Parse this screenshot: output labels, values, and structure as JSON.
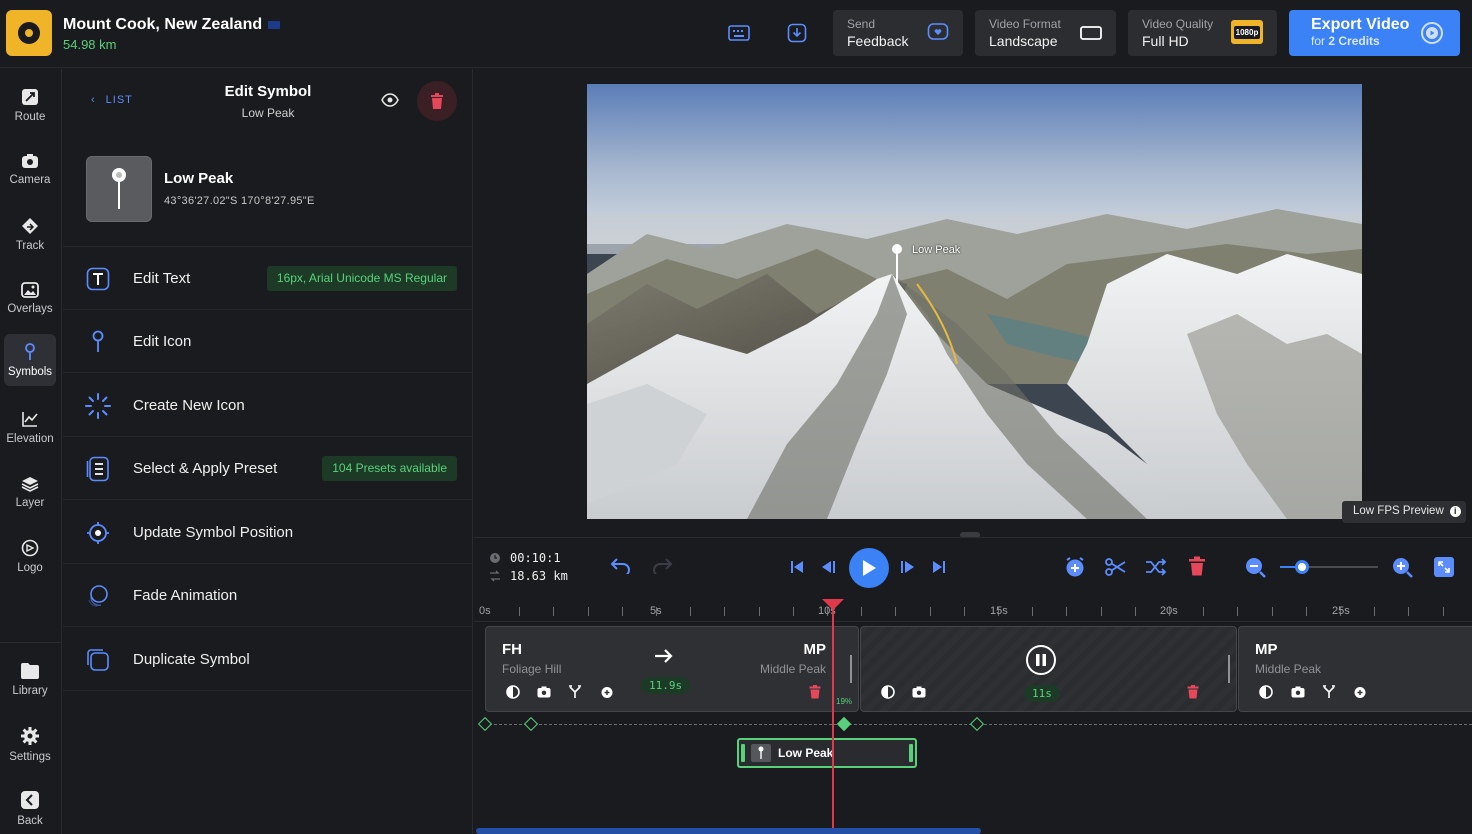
{
  "header": {
    "project_title": "Mount Cook, New Zealand",
    "distance": "54.98 km",
    "feedback_small": "Send",
    "feedback_big": "Feedback",
    "format_small": "Video Format",
    "format_big": "Landscape",
    "quality_small": "Video Quality",
    "quality_big": "Full HD",
    "quality_badge": "1080p",
    "export_label": "Export Video",
    "export_sub_prefix": "for ",
    "export_credits": "2 Credits"
  },
  "sidebar": {
    "items": [
      {
        "label": "Route",
        "icon": "route-icon"
      },
      {
        "label": "Camera",
        "icon": "camera-icon"
      },
      {
        "label": "Track",
        "icon": "track-icon"
      },
      {
        "label": "Overlays",
        "icon": "overlays-icon"
      },
      {
        "label": "Symbols",
        "icon": "pin-icon",
        "active": true
      },
      {
        "label": "Elevation",
        "icon": "elevation-icon"
      },
      {
        "label": "Layer",
        "icon": "layers-icon"
      },
      {
        "label": "Logo",
        "icon": "logo-icon"
      },
      {
        "label": "Library",
        "icon": "folder-icon"
      },
      {
        "label": "Settings",
        "icon": "gear-icon"
      },
      {
        "label": "Back",
        "icon": "back-icon"
      }
    ]
  },
  "panel": {
    "back_link": "LIST",
    "title": "Edit Symbol",
    "subtitle": "Low Peak",
    "symbol_name": "Low Peak",
    "symbol_coords": "43°36'27.02\"S 170°8'27.95\"E",
    "menu": [
      {
        "label": "Edit Text",
        "icon": "text-icon",
        "badge": "16px, Arial Unicode MS Regular"
      },
      {
        "label": "Edit Icon",
        "icon": "pin-icon",
        "badge": ""
      },
      {
        "label": "Create New Icon",
        "icon": "sparkle-icon",
        "badge": ""
      },
      {
        "label": "Select & Apply Preset",
        "icon": "preset-icon",
        "badge": "104 Presets available"
      },
      {
        "label": "Update Symbol Position",
        "icon": "target-icon",
        "badge": ""
      },
      {
        "label": "Fade Animation",
        "icon": "fade-icon",
        "badge": ""
      },
      {
        "label": "Duplicate Symbol",
        "icon": "duplicate-icon",
        "badge": ""
      }
    ]
  },
  "preview": {
    "map_label": "Low Peak",
    "fps_label": "Low FPS Preview"
  },
  "timeline": {
    "time": "00:10:1",
    "distance": "18.63 km",
    "ruler_labels": [
      "0s",
      "5s",
      "10s",
      "15s",
      "20s",
      "25s"
    ],
    "zoom_fraction": 0.22,
    "clips": [
      {
        "code_from": "FH",
        "name_from": "Foliage Hill",
        "code_to": "MP",
        "name_to": "Middle Peak",
        "duration": "11.9s",
        "percent": "19%"
      },
      {
        "duration": "11s"
      },
      {
        "code": "MP",
        "name": "Middle Peak"
      }
    ],
    "symbol_clip_label": "Low Peak"
  }
}
